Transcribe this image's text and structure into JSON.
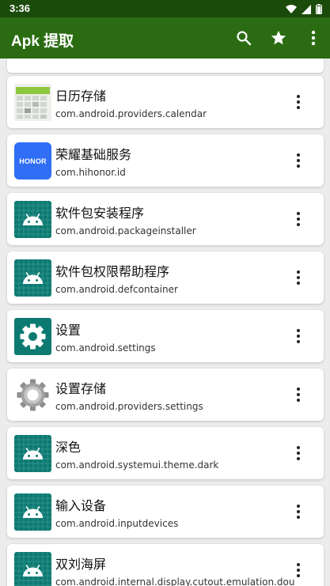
{
  "status": {
    "time": "3:36"
  },
  "appbar": {
    "title": "Apk 提取"
  },
  "apps": [
    {
      "label": "日历存储",
      "package": "com.android.providers.calendar",
      "icon": "calendar-storage-icon"
    },
    {
      "label": "荣耀基础服务",
      "package": "com.hihonor.id",
      "icon": "honor-logo-icon",
      "icon_text": "HONOR"
    },
    {
      "label": "软件包安装程序",
      "package": "com.android.packageinstaller",
      "icon": "android-icon"
    },
    {
      "label": "软件包权限帮助程序",
      "package": "com.android.defcontainer",
      "icon": "android-icon"
    },
    {
      "label": "设置",
      "package": "com.android.settings",
      "icon": "settings-gear-icon"
    },
    {
      "label": "设置存储",
      "package": "com.android.providers.settings",
      "icon": "gray-gear-icon"
    },
    {
      "label": "深色",
      "package": "com.android.systemui.theme.dark",
      "icon": "android-icon"
    },
    {
      "label": "输入设备",
      "package": "com.android.inputdevices",
      "icon": "android-icon"
    },
    {
      "label": "双刘海屏",
      "package": "com.android.internal.display.cutout.emulation.dou",
      "icon": "android-icon"
    }
  ],
  "colors": {
    "status_bar": "#1b4b0b",
    "app_bar": "#2b6c13",
    "android_teal": "#0d7a72",
    "honor_blue": "#2f6ef5"
  }
}
